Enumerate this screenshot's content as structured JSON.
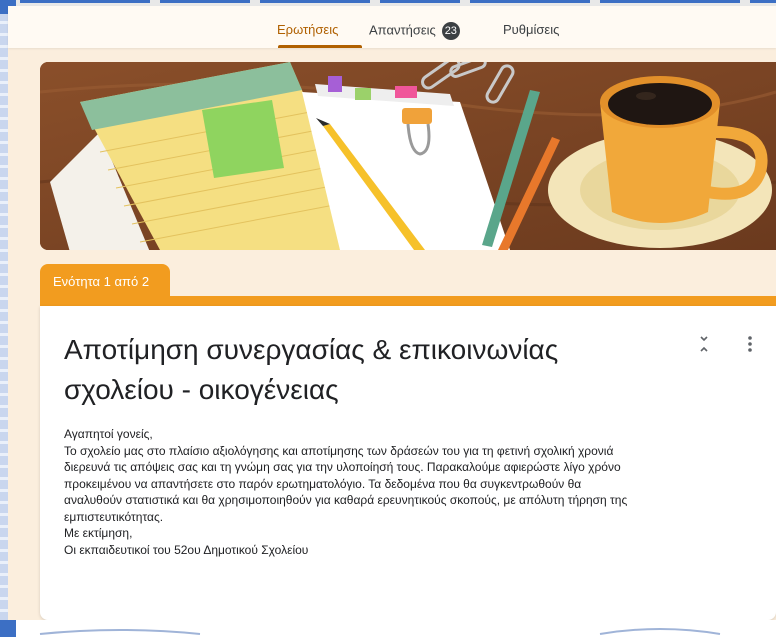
{
  "tabs": [
    {
      "label": "Ερωτήσεις",
      "active": true
    },
    {
      "label": "Απαντήσεις",
      "count": "23",
      "active": false
    },
    {
      "label": "Ρυθμίσεις",
      "active": false
    }
  ],
  "section": {
    "label": "Ενότητα 1 από 2"
  },
  "form": {
    "title_line1": "Αποτίμηση συνεργασίας & επικοινωνίας",
    "title_line2": "σχολείου - οικογένειας",
    "description": [
      "Αγαπητοί γονείς,",
      "Το σχολείο μας στο πλαίσιο αξιολόγησης και αποτίμησης των δράσεών του για τη φετινή σχολική χρονιά",
      "διερευνά τις απόψεις σας και τη γνώμη σας για την υλοποίησή τους. Παρακαλούμε αφιερώστε λίγο χρόνο",
      "προκειμένου να απαντήσετε στο παρόν ερωτηματολόγιο. Τα δεδομένα που θα συγκεντρωθούν θα",
      "αναλυθούν στατιστικά και θα χρησιμοποιηθούν για καθαρά ερευνητικούς σκοπούς, με απόλυτη τήρηση της",
      "εμπιστευτικότητας.",
      "Με εκτίμηση,",
      "Οι εκπαιδευτικοί του 52ου Δημοτικού Σχολείου"
    ]
  },
  "colors": {
    "accent": "#b06000",
    "section": "#f29c1f",
    "page_bg": "#fbeedd"
  },
  "icons": [
    "collapse-section-icon",
    "more-vert-icon"
  ]
}
